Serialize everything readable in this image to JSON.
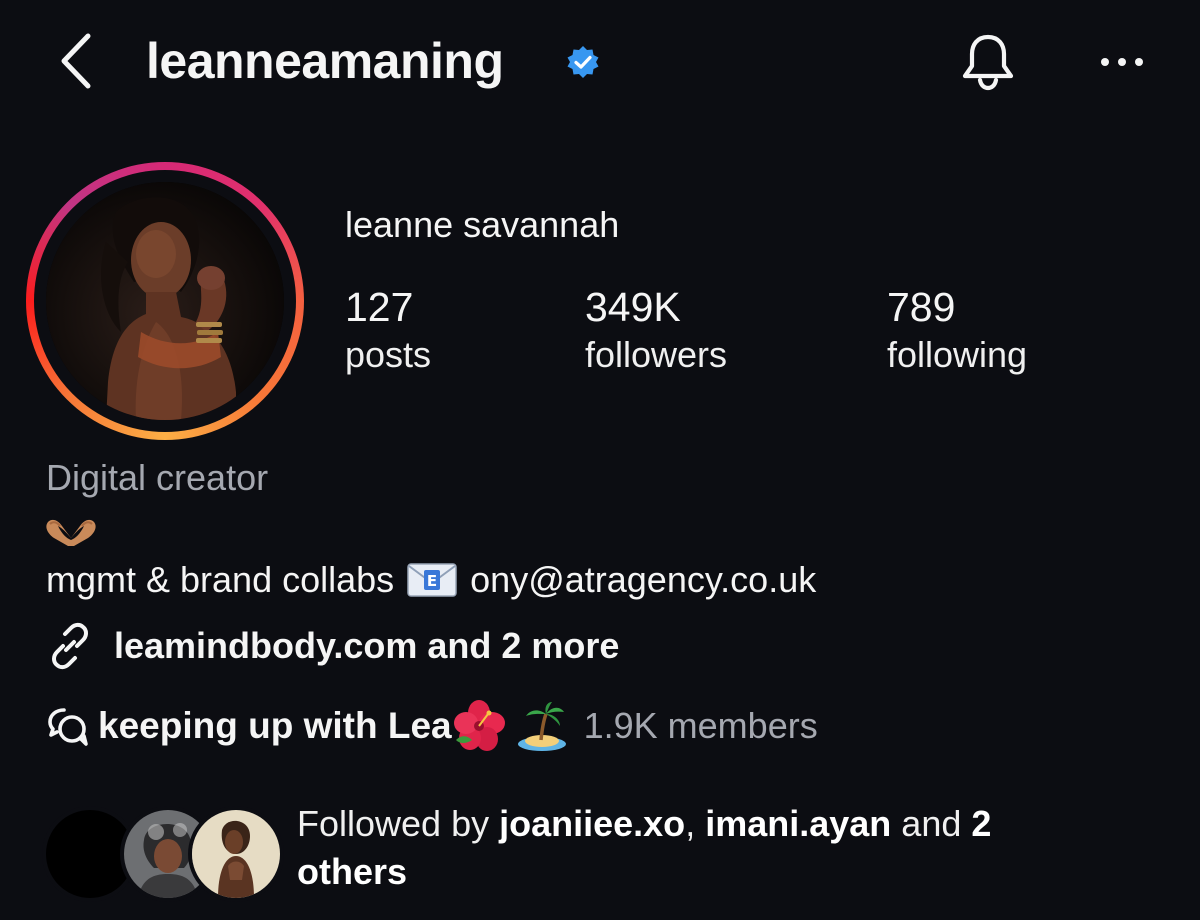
{
  "header": {
    "username": "leanneamaning",
    "verified": true,
    "accent_color": "#3897f0",
    "icons": [
      "back-icon",
      "verified-badge-icon",
      "bell-icon",
      "more-icon"
    ]
  },
  "profile": {
    "display_name": "leanne savannah",
    "stats": [
      {
        "value": "127",
        "label": "posts"
      },
      {
        "value": "349K",
        "label": "followers"
      },
      {
        "value": "789",
        "label": "following"
      }
    ]
  },
  "bio": {
    "category": "Digital creator",
    "emoji_line": "heart-hands-emoji",
    "contact_prefix": "mgmt & brand collabs",
    "contact_icon": "envelope-emoji",
    "contact_email": "ony@atragency.co.uk",
    "link_text": "leamindbody.com and 2 more",
    "channel_name": "keeping up with Lea",
    "channel_emojis": [
      "hibiscus-emoji",
      "desert-island-emoji"
    ],
    "channel_members": "1.9K members"
  },
  "followed_by": {
    "prefix": "Followed by ",
    "user1": "joaniiee.xo",
    "separator": ", ",
    "user2": "imani.ayan",
    "middle": " and ",
    "count": "2",
    "suffix": "others"
  },
  "colors": {
    "background": "#0c0d12",
    "secondary_text": "#a5a8b0",
    "story_ring": [
      "#d62976",
      "#f56040",
      "#fcaf45"
    ]
  }
}
